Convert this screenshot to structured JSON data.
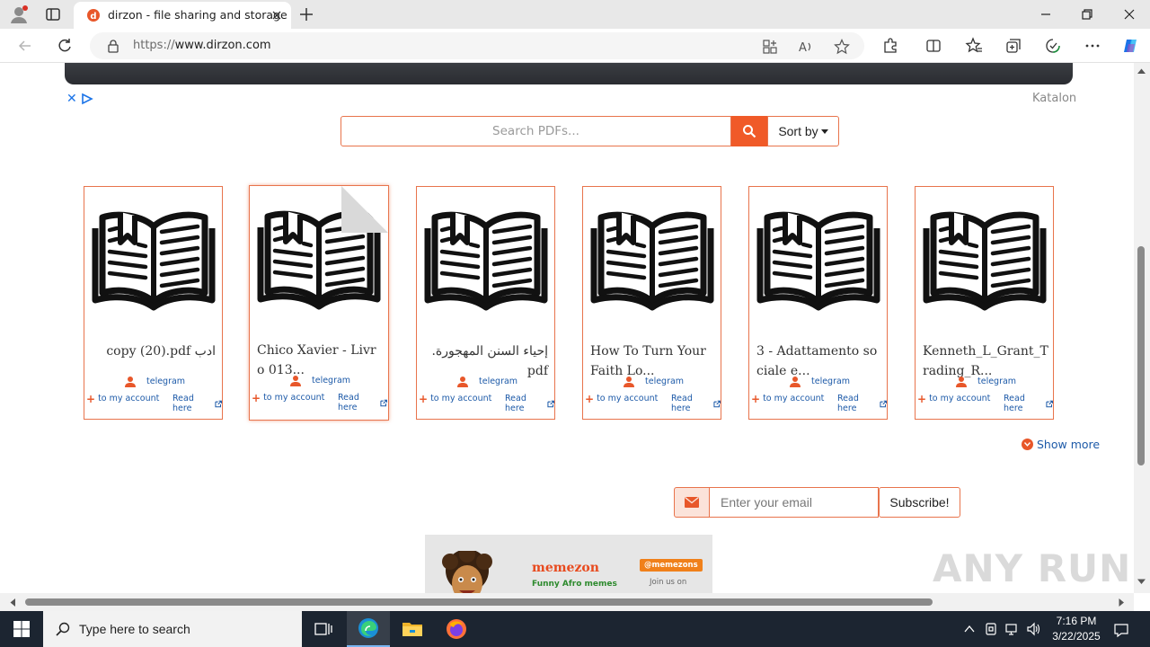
{
  "browser": {
    "tab_title": "dirzon - file sharing and storage",
    "url_prefix": "https://",
    "url_host": "www.dirzon.com",
    "colors": {
      "favicon": "#e8572a",
      "accent": "#1a73e8"
    }
  },
  "ad": {
    "close_glyph": "✕",
    "advertiser": "Katalon"
  },
  "search": {
    "placeholder": "Search PDFs...",
    "sort_label": "Sort by"
  },
  "cards": [
    {
      "title": "ادب copy (20).pdf",
      "rtl": true,
      "author": "telegram",
      "add_label": "to my account",
      "read_label": "Read here"
    },
    {
      "title": "Chico Xavier - Livro 013...",
      "rtl": false,
      "author": "telegram",
      "add_label": "to my account",
      "read_label": "Read here"
    },
    {
      "title": "إحياء السنن المهجورة.pdf",
      "rtl": true,
      "author": "telegram",
      "add_label": "to my account",
      "read_label": "Read here"
    },
    {
      "title": "How To Turn Your Faith Lo...",
      "rtl": false,
      "author": "telegram",
      "add_label": "to my account",
      "read_label": "Read here"
    },
    {
      "title": "3 - Adattamento sociale e...",
      "rtl": false,
      "author": "telegram",
      "add_label": "to my account",
      "read_label": "Read here"
    },
    {
      "title": "Kenneth_L_Grant_Trading_R...",
      "rtl": false,
      "author": "telegram",
      "add_label": "to my account",
      "read_label": "Read here"
    }
  ],
  "show_more": "Show more",
  "subscribe": {
    "placeholder": "Enter your email",
    "button": "Subscribe!"
  },
  "promo": {
    "brand": "memezon",
    "tagline": "Funny Afro memes",
    "handle": "@memezons",
    "join": "Join us on"
  },
  "watermark": "ANY RUN",
  "taskbar": {
    "search_placeholder": "Type here to search",
    "time": "7:16 PM",
    "date": "3/22/2025"
  }
}
